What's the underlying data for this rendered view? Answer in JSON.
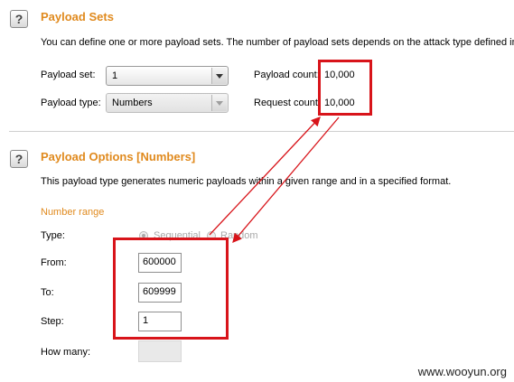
{
  "payload_sets": {
    "help_icon": "?",
    "title": "Payload Sets",
    "description": "You can define one or more payload sets. The number of payload sets depends on the attack type defined in",
    "set_label": "Payload set:",
    "set_value": "1",
    "type_label": "Payload type:",
    "type_value": "Numbers",
    "count_label": "Payload count:",
    "count_value": "10,000",
    "request_label": "Request count:",
    "request_value": "10,000"
  },
  "payload_options": {
    "help_icon": "?",
    "title": "Payload Options [Numbers]",
    "description": "This payload type generates numeric payloads within a given range and in a specified format.",
    "number_range_label": "Number range",
    "type_label": "Type:",
    "sequential_label": "Sequential",
    "random_label": "Random",
    "from_label": "From:",
    "from_value": "600000",
    "to_label": "To:",
    "to_value": "609999",
    "step_label": "Step:",
    "step_value": "1",
    "how_many_label": "How many:",
    "how_many_value": ""
  },
  "watermark": "www.wooyun.org",
  "colors": {
    "heading": "#e08a1e",
    "annotation": "#d8141a"
  },
  "icons": [
    "help-icon",
    "dropdown-arrow-icon",
    "radio-icon",
    "annotation-arrow-icon"
  ]
}
